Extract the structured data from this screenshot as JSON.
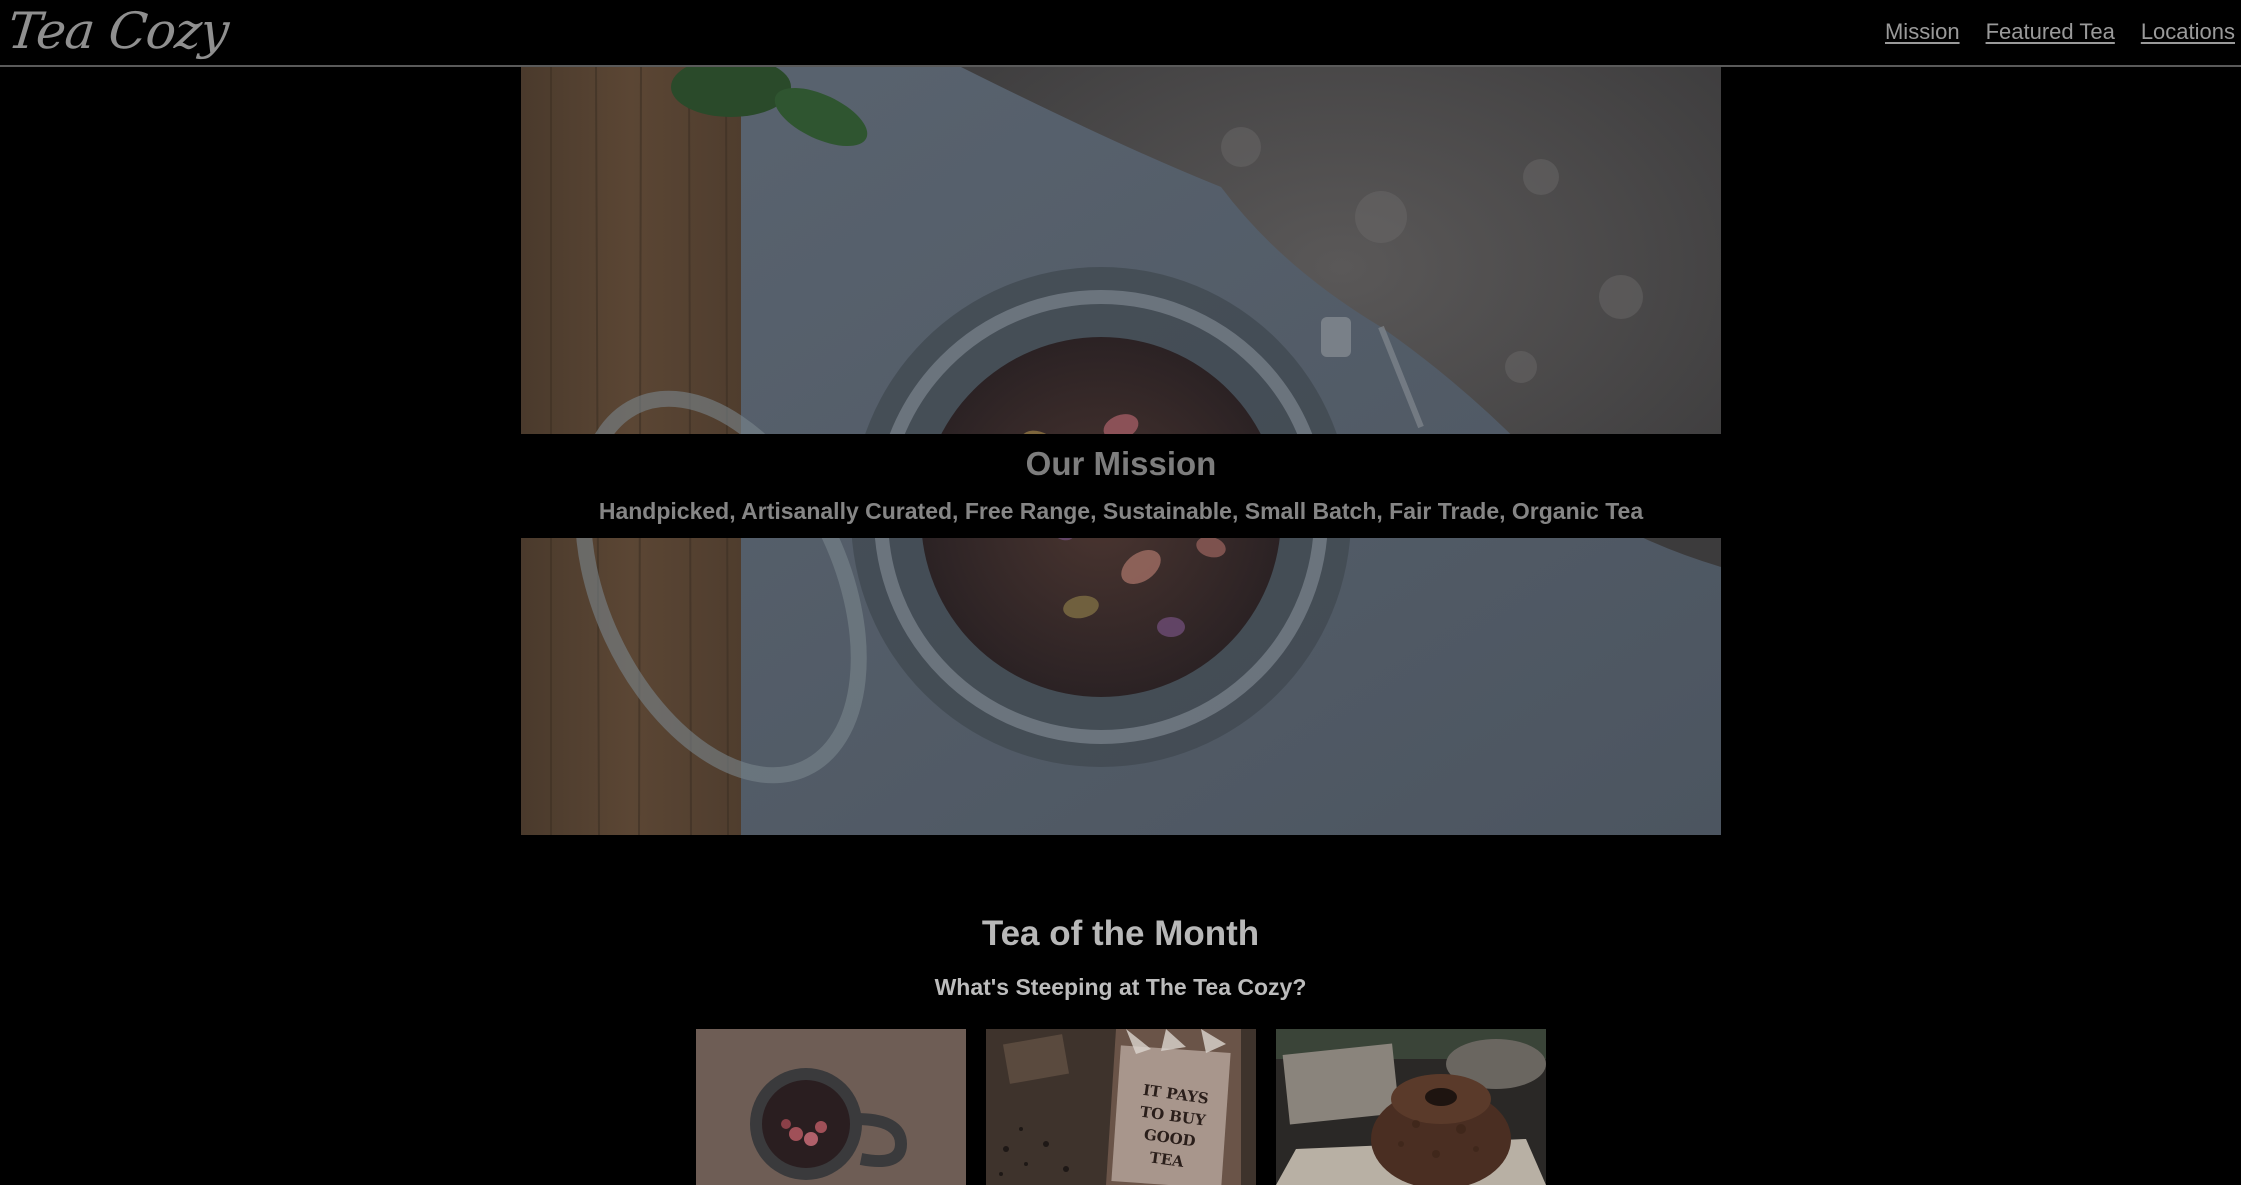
{
  "header": {
    "logo": "Tea Cozy",
    "nav": [
      {
        "label": "Mission"
      },
      {
        "label": "Featured Tea"
      },
      {
        "label": "Locations"
      }
    ]
  },
  "mission": {
    "title": "Our Mission",
    "subtitle": "Handpicked, Artisanally Curated, Free Range, Sustainable, Small Batch, Fair Trade, Organic Tea"
  },
  "tea_of_month": {
    "title": "Tea of the Month",
    "subtitle": "What's Steeping at The Tea Cozy?",
    "cards": [
      {
        "image": "mug-of-berry-tea"
      },
      {
        "image": "box-it-pays-to-buy-good-tea",
        "sign": [
          "IT PAYS",
          "TO BUY",
          "GOOD",
          "TEA"
        ]
      },
      {
        "image": "bundt-cake"
      }
    ]
  },
  "colors": {
    "background": "#000000",
    "header_border": "#5a5a5a",
    "text_muted": "#8f8f8f",
    "text_light": "#bcbcbc"
  }
}
